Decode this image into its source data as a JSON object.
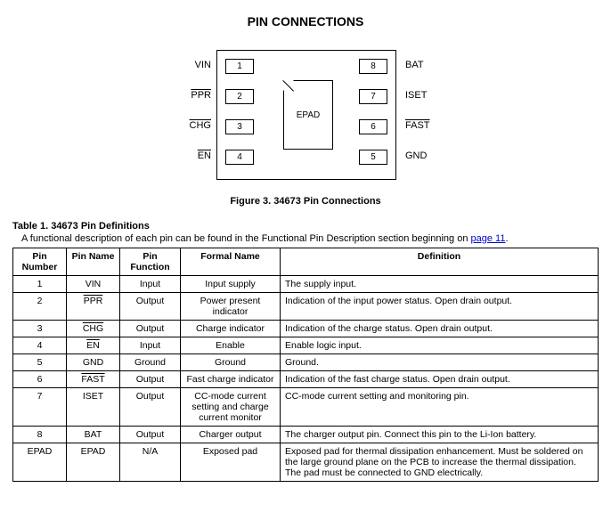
{
  "title": "PIN CONNECTIONS",
  "figure_caption": "Figure 3. 34673 Pin Connections",
  "epad_label": "EPAD",
  "pin_labels": {
    "left": [
      {
        "num": "1",
        "name": "VIN",
        "overline": false
      },
      {
        "num": "2",
        "name": "PPR",
        "overline": true
      },
      {
        "num": "3",
        "name": "CHG",
        "overline": true
      },
      {
        "num": "4",
        "name": "EN",
        "overline": true
      }
    ],
    "right": [
      {
        "num": "8",
        "name": "BAT",
        "overline": false
      },
      {
        "num": "7",
        "name": "ISET",
        "overline": false
      },
      {
        "num": "6",
        "name": "FAST",
        "overline": true
      },
      {
        "num": "5",
        "name": "GND",
        "overline": false
      }
    ]
  },
  "table_title": "Table 1.  34673 Pin Definitions",
  "table_note_pre": "A functional description of each pin can be found in the Functional Pin Description section beginning on ",
  "table_note_link": "page 11",
  "table_note_post": ".",
  "columns": [
    "Pin Number",
    "Pin Name",
    "Pin Function",
    "Formal Name",
    "Definition"
  ],
  "rows": [
    {
      "num": "1",
      "name": "VIN",
      "overline": false,
      "func": "Input",
      "formal": "Input supply",
      "def": "The supply input."
    },
    {
      "num": "2",
      "name": "PPR",
      "overline": true,
      "func": "Output",
      "formal": "Power present indicator",
      "def": "Indication of the input power status. Open drain output."
    },
    {
      "num": "3",
      "name": "CHG",
      "overline": true,
      "func": "Output",
      "formal": "Charge indicator",
      "def": "Indication of the charge status. Open drain output."
    },
    {
      "num": "4",
      "name": "EN",
      "overline": true,
      "func": "Input",
      "formal": "Enable",
      "def": "Enable logic input."
    },
    {
      "num": "5",
      "name": "GND",
      "overline": false,
      "func": "Ground",
      "formal": "Ground",
      "def": "Ground."
    },
    {
      "num": "6",
      "name": "FAST",
      "overline": true,
      "func": "Output",
      "formal": "Fast charge indicator",
      "def": "Indication of the fast charge status. Open drain output."
    },
    {
      "num": "7",
      "name": "ISET",
      "overline": false,
      "func": "Output",
      "formal": "CC-mode current setting and charge current monitor",
      "def": "CC-mode current setting and monitoring pin."
    },
    {
      "num": "8",
      "name": "BAT",
      "overline": false,
      "func": "Output",
      "formal": "Charger output",
      "def": "The charger output pin. Connect this pin to the Li-Ion battery."
    },
    {
      "num": "EPAD",
      "name": "EPAD",
      "overline": false,
      "func": "N/A",
      "formal": "Exposed pad",
      "def": "Exposed pad for thermal dissipation enhancement. Must be soldered on the large ground plane on the PCB to increase the thermal dissipation. The pad must be connected to GND electrically."
    }
  ]
}
